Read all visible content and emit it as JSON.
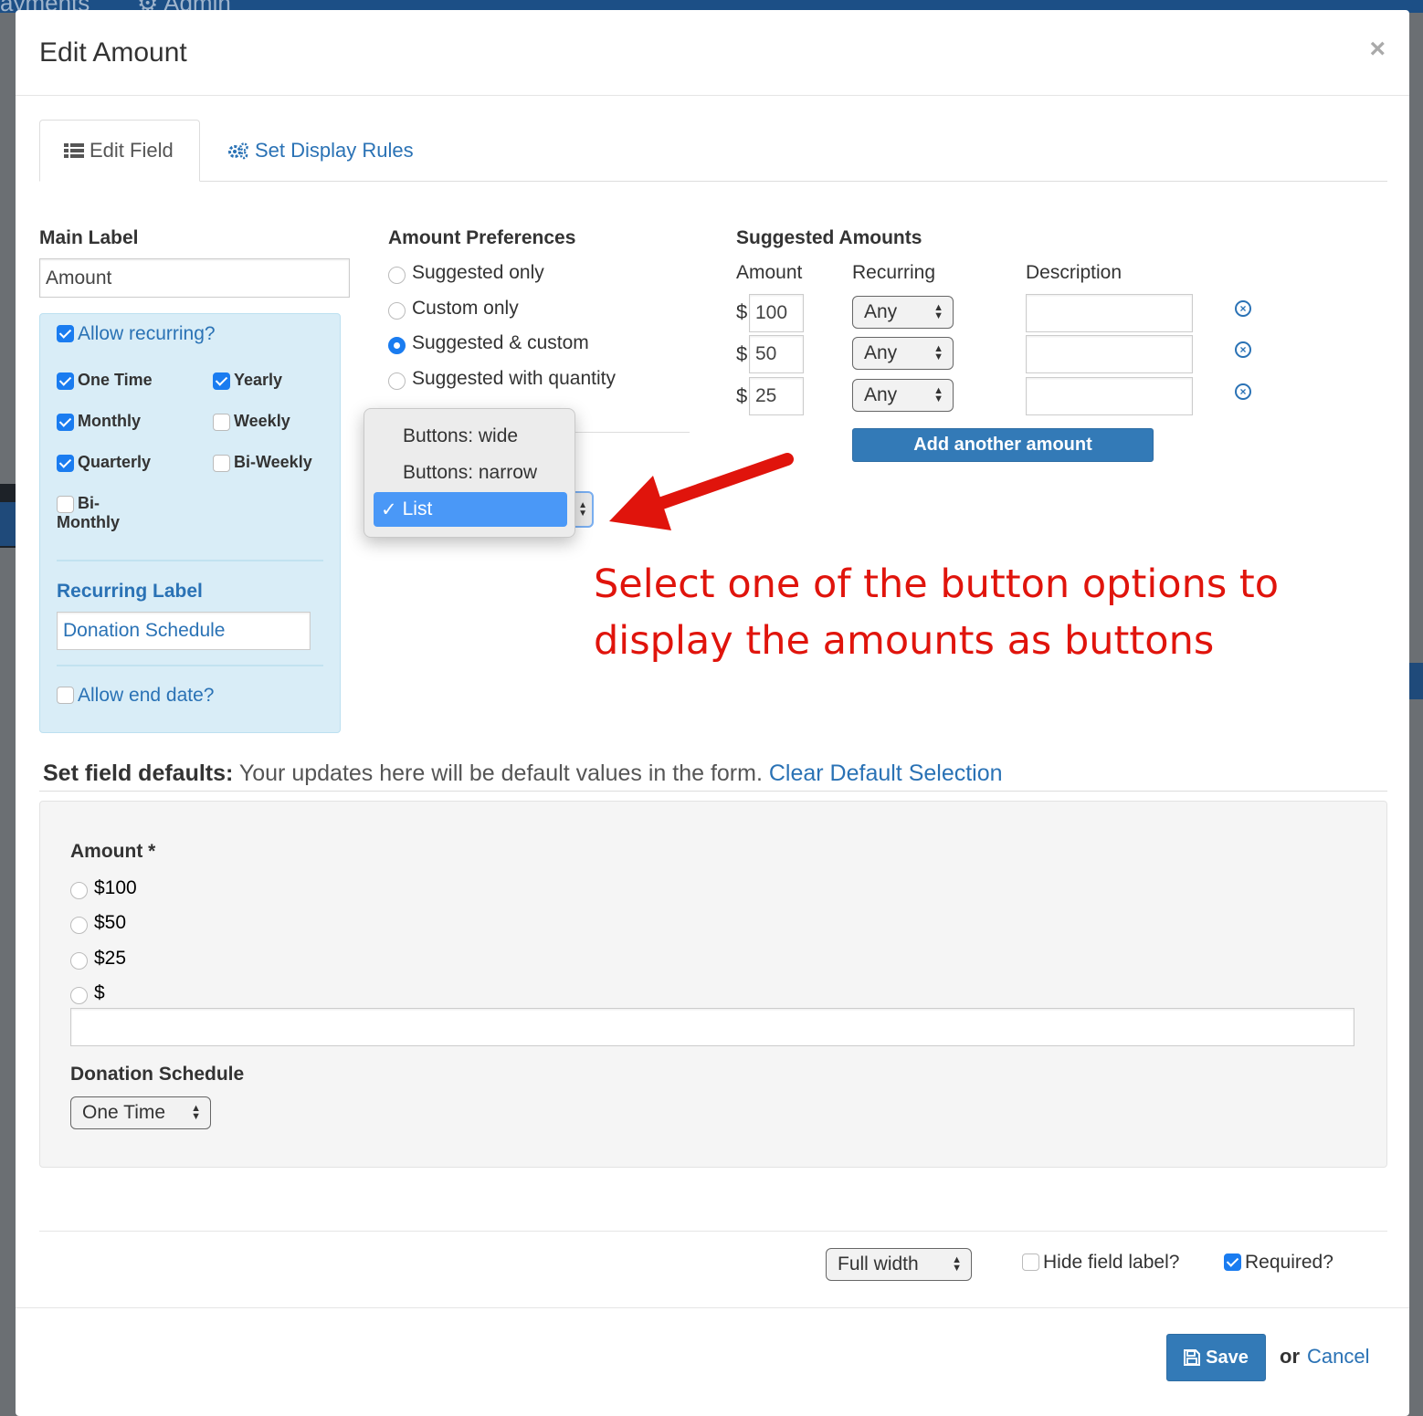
{
  "background": {
    "nav_items": [
      "ayments",
      "Admin"
    ]
  },
  "modal": {
    "title": "Edit Amount",
    "close_label": "×"
  },
  "tabs": [
    {
      "label": "Edit Field",
      "icon": "list-icon",
      "active": true
    },
    {
      "label": "Set Display Rules",
      "icon": "gears-icon",
      "active": false
    }
  ],
  "main_label": {
    "heading": "Main Label",
    "value": "Amount"
  },
  "recurring": {
    "allow_label": "Allow recurring?",
    "allow_checked": true,
    "options": [
      {
        "label": "One Time",
        "checked": true
      },
      {
        "label": "Yearly",
        "checked": true
      },
      {
        "label": "Monthly",
        "checked": true
      },
      {
        "label": "Weekly",
        "checked": false
      },
      {
        "label": "Quarterly",
        "checked": true
      },
      {
        "label": "Bi-Weekly",
        "checked": false
      },
      {
        "label": "Bi-",
        "label2": "Monthly",
        "checked": false
      }
    ],
    "recurring_label_heading": "Recurring Label",
    "recurring_label_value": "Donation Schedule",
    "end_date_label": "Allow end date?",
    "end_date_checked": false
  },
  "amount_preferences": {
    "heading": "Amount Preferences",
    "options": [
      {
        "label": "Suggested only",
        "selected": false
      },
      {
        "label": "Custom only",
        "selected": false
      },
      {
        "label": "Suggested & custom",
        "selected": true
      },
      {
        "label": "Suggested with quantity",
        "selected": false
      }
    ]
  },
  "display_dropdown": {
    "options": [
      "Buttons: wide",
      "Buttons: narrow",
      "List"
    ],
    "selected": "List",
    "check_mark": "✓"
  },
  "suggested_amounts": {
    "heading": "Suggested Amounts",
    "columns": [
      "Amount",
      "Recurring",
      "Description"
    ],
    "currency_symbol": "$",
    "rows": [
      {
        "amount": "100",
        "recurring": "Any",
        "description": ""
      },
      {
        "amount": "50",
        "recurring": "Any",
        "description": ""
      },
      {
        "amount": "25",
        "recurring": "Any",
        "description": ""
      }
    ],
    "add_button": "Add another amount"
  },
  "annotation": {
    "line1": "Select one of the button options to",
    "line2": "display the amounts as buttons"
  },
  "defaults": {
    "title_bold": "Set field defaults:",
    "title_text": " Your updates here will be default values in the form. ",
    "clear_link": "Clear Default Selection",
    "amount_label": "Amount *",
    "amount_options": [
      "$100",
      "$50",
      "$25",
      "$"
    ],
    "custom_amount_value": "",
    "schedule_label": "Donation Schedule",
    "schedule_value": "One Time"
  },
  "footer_options": {
    "width_value": "Full width",
    "hide_label": "Hide field label?",
    "hide_label_checked": false,
    "required_label": "Required?",
    "required_checked": true
  },
  "actions": {
    "save": "Save",
    "or": "or",
    "cancel": "Cancel"
  },
  "colors": {
    "accent": "#337ab7",
    "link": "#2a72b5",
    "annotation": "#e0140c",
    "recurring_panel": "#d9edf7"
  }
}
